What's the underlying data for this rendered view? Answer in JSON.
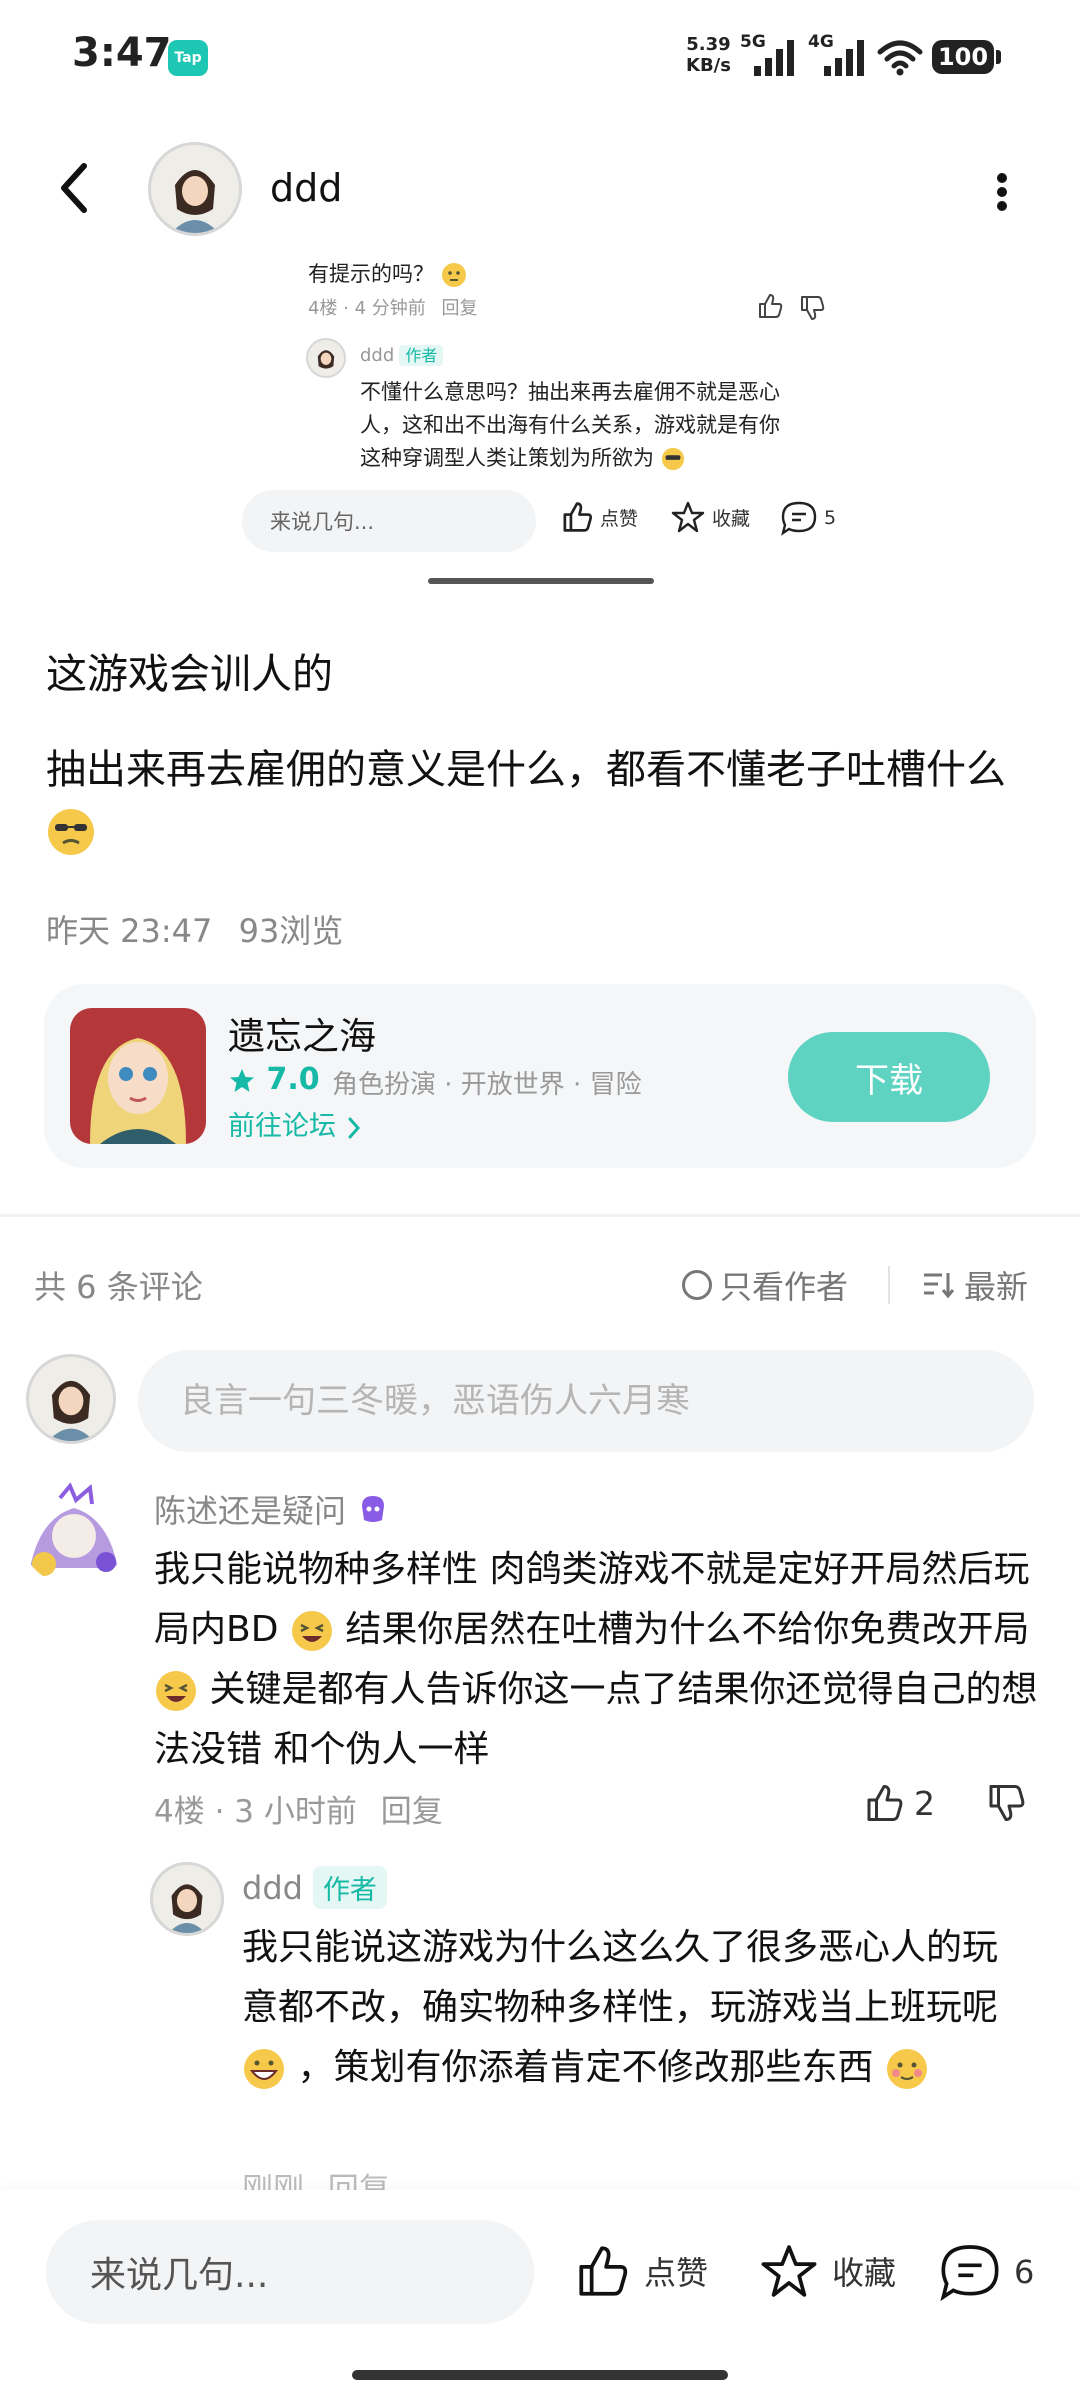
{
  "status_bar": {
    "time": "3:47",
    "app_badge": "Tap",
    "net_speed_value": "5.39",
    "net_speed_unit": "KB/s",
    "signal_1_label": "5G",
    "signal_2_label": "4G",
    "battery": "100"
  },
  "header": {
    "author_name": "ddd"
  },
  "preview": {
    "question": "有提示的吗？",
    "question_meta": "4楼 · 4 分钟前",
    "question_reply": "回复",
    "reply_user": "ddd",
    "reply_tag": "作者",
    "reply_line_1": "不懂什么意思吗？抽出来再去雇佣不就是恶心",
    "reply_line_2": "人，这和出不出海有什么关系，游戏就是有你",
    "reply_line_3": "这种穿调型人类让策划为所欲为",
    "input_placeholder": "来说几句...",
    "like_label": "点赞",
    "collect_label": "收藏",
    "comment_count": "5"
  },
  "post": {
    "title": "这游戏会训人的",
    "body": "抽出来再去雇佣的意义是什么，都看不懂老子吐槽什么",
    "time": "昨天 23:47",
    "views": "93浏览"
  },
  "game": {
    "name": "遗忘之海",
    "rating": "7.0",
    "tags": "角色扮演 · 开放世界 · 冒险",
    "forum_link": "前往论坛",
    "download_label": "下载"
  },
  "comments_header": {
    "count_text": "共 6 条评论",
    "only_author": "只看作者",
    "sort": "最新"
  },
  "comment_input": {
    "placeholder": "良言一句三冬暖，恶语伤人六月寒"
  },
  "comments": [
    {
      "user": "陈述还是疑问",
      "text_1": "我只能说物种多样性  肉鸽类游戏不就是定好开局然后玩局内BD",
      "text_2": "  结果你居然在吐槽为什么不给你免费改开局",
      "text_3": "  关键是都有人告诉你这一点了结果你还觉得自己的想法没错   和个伪人一样",
      "floor_time": "4楼 · 3 小时前",
      "reply": "回复",
      "likes": "2"
    }
  ],
  "reply": {
    "user": "ddd",
    "tag": "作者",
    "text_1": "我只能说这游戏为什么这么久了很多恶心人的玩意都不改，确实物种多样性，玩游戏当上班玩呢",
    "text_2": "，策划有你添着肯定不修改那些东西",
    "time": "刚刚",
    "reply_label": "回复"
  },
  "bottom_bar": {
    "input_placeholder": "来说几句...",
    "like_label": "点赞",
    "collect_label": "收藏",
    "comment_count": "6"
  },
  "colors": {
    "accent": "#16b9a6",
    "download_button": "#5fd3c1",
    "input_bg": "#f3f4f6"
  }
}
